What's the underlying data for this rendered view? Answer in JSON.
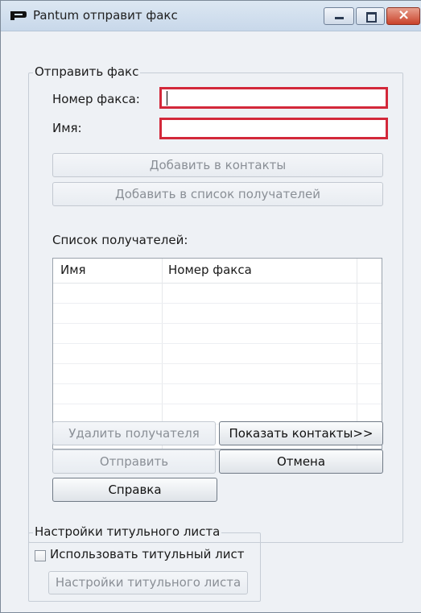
{
  "window": {
    "title": "Pantum отправит факс",
    "controls": [
      "minimize-icon",
      "maximize-icon",
      "close-icon"
    ]
  },
  "send_fax_group": {
    "title": "Отправить факс",
    "fax_number_label": "Номер факса:",
    "fax_number_value": "",
    "name_label": "Имя:",
    "name_value": "",
    "add_to_contacts": "Добавить в контакты",
    "add_to_recipients": "Добавить в список получателей",
    "recipients_label": "Список получателей:",
    "table": {
      "columns": [
        "Имя",
        "Номер факса"
      ],
      "rows": []
    },
    "remove_recipient": "Удалить получателя",
    "show_contacts": "Показать контакты>>",
    "send": "Отправить",
    "cancel": "Отмена",
    "help": "Справка"
  },
  "cover_page_group": {
    "title": "Настройки титульного листа",
    "use_cover_page_label": "Использовать титульный лист",
    "use_cover_page_checked": false,
    "cover_page_settings": "Настройки титульного листа"
  },
  "colors": {
    "required_field_border": "#d3283a",
    "window_background": "#eef1f5"
  }
}
